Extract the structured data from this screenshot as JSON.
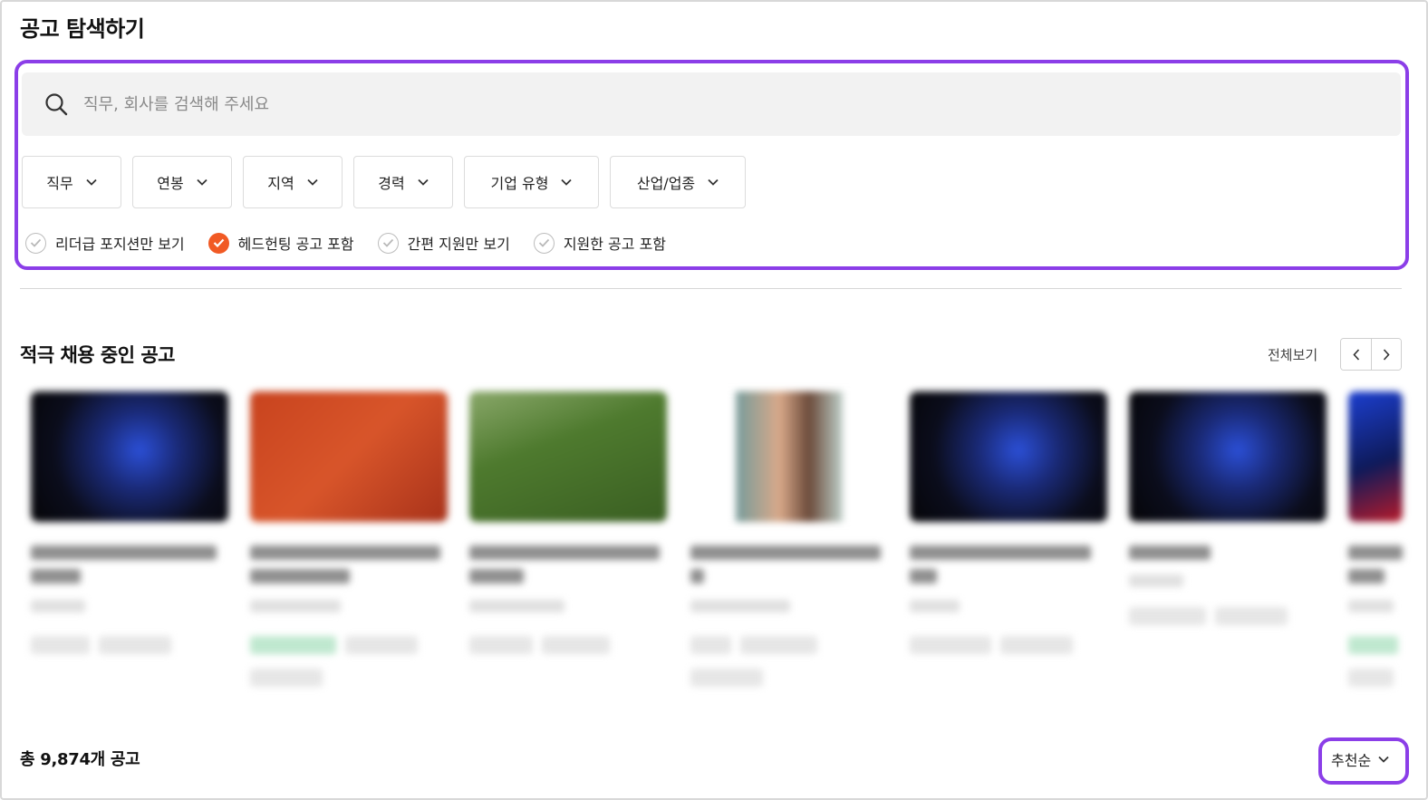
{
  "page": {
    "title": "공고 탐색하기"
  },
  "search": {
    "placeholder": "직무, 회사를 검색해 주세요",
    "value": ""
  },
  "filters": [
    {
      "label": "직무"
    },
    {
      "label": "연봉"
    },
    {
      "label": "지역"
    },
    {
      "label": "경력"
    },
    {
      "label": "기업 유형"
    },
    {
      "label": "산업/업종"
    }
  ],
  "checkboxes": [
    {
      "label": "리더급 포지션만 보기",
      "checked": false
    },
    {
      "label": "헤드헌팅 공고 포함",
      "checked": true
    },
    {
      "label": "간편 지원만 보기",
      "checked": false
    },
    {
      "label": "지원한 공고 포함",
      "checked": false
    }
  ],
  "featured": {
    "title": "적극 채용 중인 공고",
    "view_all": "전체보기"
  },
  "list": {
    "total_label": "총 9,874개 공고",
    "sort_label": "추천순"
  },
  "colors": {
    "accent_purple": "#8b3ee8",
    "checked_orange": "#f15a24"
  },
  "icons": {
    "search": "search-icon",
    "dropdown": "chevron-down-icon",
    "prev": "chevron-left-icon",
    "next": "chevron-right-icon",
    "check": "check-icon"
  }
}
